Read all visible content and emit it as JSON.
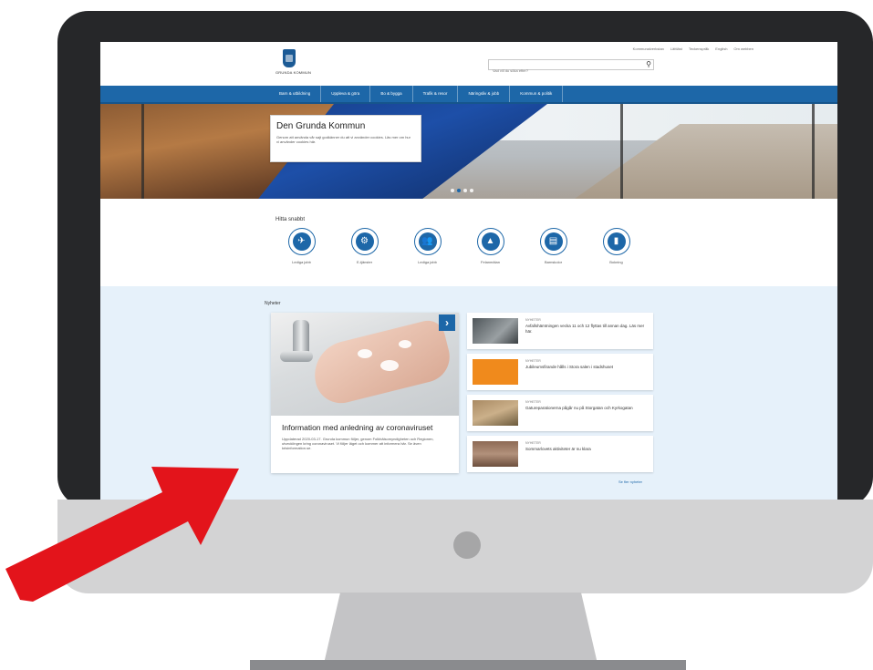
{
  "window": {
    "top_links": [
      "Kommunalverkstan",
      "Lättläst",
      "Teckenspråk",
      "English",
      "Om webben"
    ],
    "logo_text": "GRUNDA KOMMUN",
    "search": {
      "placeholder": "Vad vill du söka efter?",
      "icon": "search-icon"
    }
  },
  "nav": {
    "items": [
      "Barn & utbildning",
      "Uppleva & göra",
      "Bo & bygga",
      "Trafik & resor",
      "Näringsliv & jobb",
      "Kommun & politik"
    ]
  },
  "hero": {
    "title": "Den Grunda Kommun",
    "text": "Genom att använda vår sajt godkänner du att vi använder cookies. Läs mer om hur vi använder cookies här.",
    "slide_count": 4,
    "active_slide": 1
  },
  "quick": {
    "title": "Hitta snabbt",
    "items": [
      {
        "label": "Lediga jobb",
        "icon": "briefcase-icon",
        "glyph": "✈"
      },
      {
        "label": "E-tjänster",
        "icon": "gear-icon",
        "glyph": "⚙"
      },
      {
        "label": "Lediga jobb",
        "icon": "people-icon",
        "glyph": "👥"
      },
      {
        "label": "Felanmälan",
        "icon": "warning-icon",
        "glyph": "▲"
      },
      {
        "label": "Barnskolor",
        "icon": "document-icon",
        "glyph": "▤"
      },
      {
        "label": "Bokning",
        "icon": "calendar-icon",
        "glyph": "▮"
      }
    ]
  },
  "news": {
    "heading": "Nyheter",
    "main": {
      "title": "Information med anledning av coronaviruset",
      "text": "Uppdaterad 2020-03-17. Grunda kommun följer, genom Folkhälsomyndigheten och Regionen, utvecklingen kring coronaviruset. Vi följer läget och kommer att informera här. Se även krisinformation.se."
    },
    "side_items": [
      {
        "tag": "Nyheter",
        "text": "Avfallshämtningen vecka 11 och 12 flyttas till annan dag. Läs mer här."
      },
      {
        "tag": "Nyheter",
        "text": "Jubileumsfirande hålls i Stora salen i stadshuset"
      },
      {
        "tag": "Nyheter",
        "text": "Gatureparationerna pågår nu på Storgatan och Kyrkogatan"
      },
      {
        "tag": "Nyheter",
        "text": "Sommarlovets aktiviteter är nu klara"
      }
    ],
    "see_all": "Se fler nyheter"
  },
  "colors": {
    "brand": "#1d67a8",
    "monitor": "#262729",
    "arrow": "#e3141b"
  }
}
